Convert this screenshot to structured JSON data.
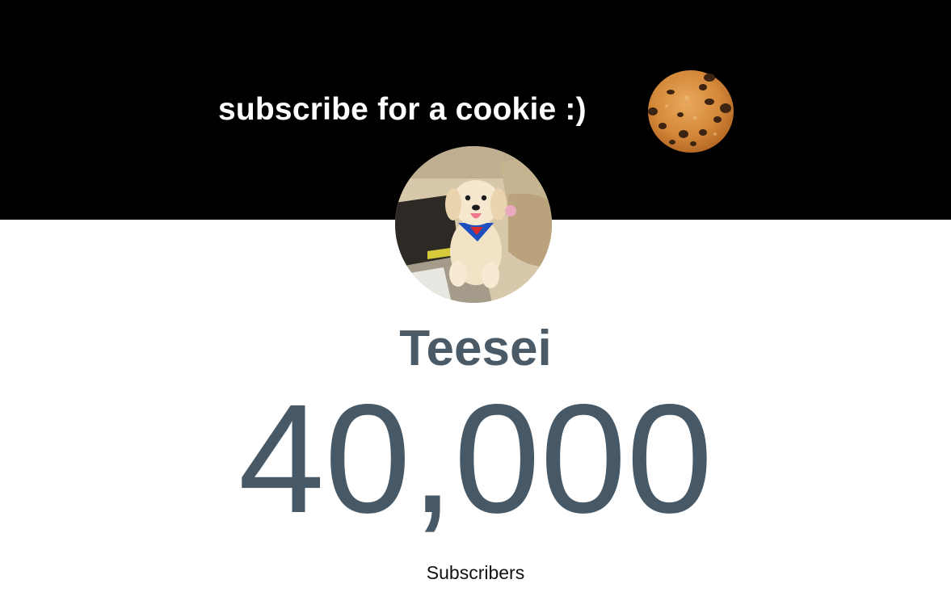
{
  "banner": {
    "text": "subscribe for a cookie :)",
    "background_color": "#000000",
    "cookie_icon": "chocolate-chip-cookie-icon"
  },
  "channel": {
    "name": "Teesei",
    "avatar": "puppy-avatar"
  },
  "counter": {
    "value": "40,000",
    "label": "Subscribers",
    "value_color": "#475966"
  }
}
